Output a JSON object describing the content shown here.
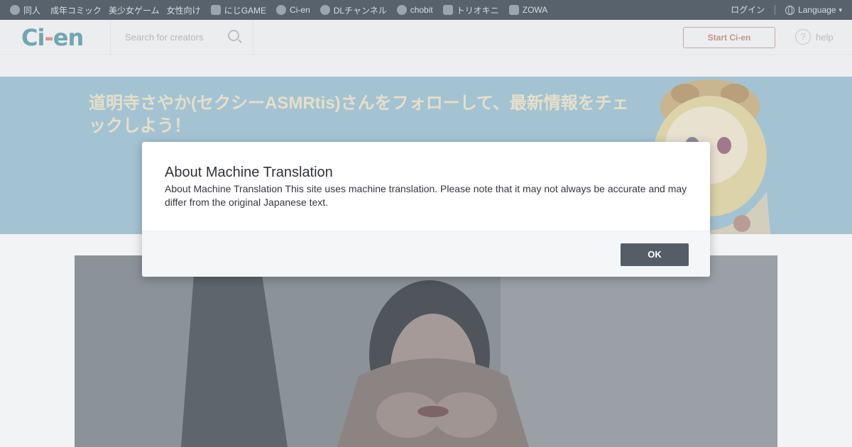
{
  "topbar": {
    "sites": [
      {
        "label": "同人",
        "icon": "dlsite-icon"
      },
      {
        "label": "成年コミック",
        "icon": ""
      },
      {
        "label": "美少女ゲーム",
        "icon": ""
      },
      {
        "label": "女性向け",
        "icon": ""
      },
      {
        "label": "にじGAME",
        "icon": "nijigame-icon"
      },
      {
        "label": "Ci-en",
        "icon": "cien-icon"
      },
      {
        "label": "DLチャンネル",
        "icon": "dlchannel-icon"
      },
      {
        "label": "chobit",
        "icon": "chobit-icon"
      },
      {
        "label": "トリオキニ",
        "icon": "triokini-icon"
      },
      {
        "label": "ZOWA",
        "icon": "zowa-icon"
      }
    ],
    "login": "ログイン",
    "language": "Language"
  },
  "header": {
    "logo_main": "Ci",
    "logo_dash": "-",
    "logo_end": "en",
    "search_placeholder": "Search for creators",
    "start_button": "Start Ci-en",
    "help": "help",
    "help_glyph": "?"
  },
  "hero": {
    "text": "道明寺さやか(セクシーASMRtis)さんをフォローして、最新情報をチェックしよう！"
  },
  "modal": {
    "title": "About Machine Translation",
    "body": "About Machine Translation This site uses machine translation. Please note that it may not always be accurate and may differ from the original Japanese text.",
    "ok": "OK"
  },
  "colors": {
    "topbar": "#58626c",
    "hero": "#a3c3d3",
    "ok_button": "#555e66"
  }
}
